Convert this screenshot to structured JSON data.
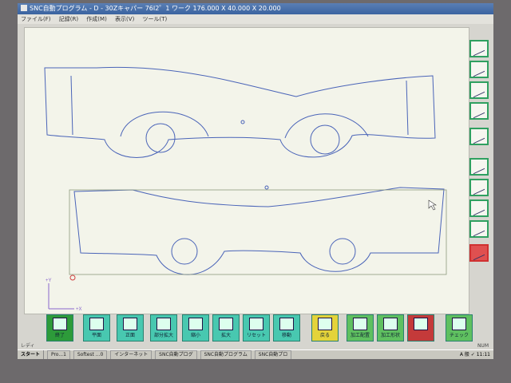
{
  "window": {
    "title": "SNC自動プログラム - D - 30Zキャパー 76I2゜1  ワーク 176.000 X 40.000 X 20.000"
  },
  "menu": {
    "items": [
      "ファイル(F)",
      "記録(R)",
      "作成(M)",
      "表示(V)",
      "ツール(T)"
    ]
  },
  "canvas": {
    "axis_y": "+Y",
    "axis_x": "+X"
  },
  "right_panel": {
    "buttons": [
      "hand-tool-icon",
      "hand-tool-icon",
      "hand-tool-icon",
      "hand-tool-icon",
      "number-1-icon",
      "drill-icon",
      "line-icon",
      "line-icon",
      "line-icon",
      "rectangle-icon"
    ]
  },
  "toolbar": {
    "end": "終了",
    "flat": "平面",
    "front": "正面",
    "partial_zoom": "部分拡大",
    "reduce": "縮小",
    "expand": "拡大",
    "reset": "リセット",
    "move": "移動",
    "back": "戻る",
    "process_layout": "加工配置",
    "process_shape": "加工形状",
    "program": "",
    "check": "チェック"
  },
  "status": {
    "text": "レディ",
    "right": "NUM"
  },
  "taskbar": {
    "start": "スタート",
    "items": [
      "Pro...1",
      "Softest ...0",
      "インターネット",
      "SNC自動プログ",
      "SNC自動プログラム",
      "SNC自動プロ"
    ],
    "clock": "A 般 ✓ 11:11"
  },
  "colors": {
    "outline": "#4a64b8",
    "toolbar_button": "#48c8b0",
    "accent_green": "#2fa060"
  }
}
